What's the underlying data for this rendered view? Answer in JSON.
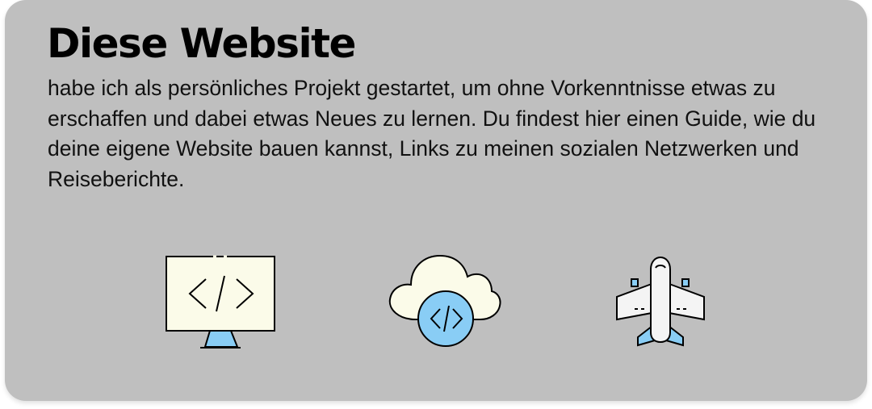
{
  "card": {
    "title": "Diese Website",
    "description": "habe ich als persönliches Projekt gestartet, um ohne Vorkenntnisse etwas zu erschaffen und dabei etwas Neues zu lernen. Du findest hier einen Guide, wie du deine eigene Website bauen kannst, Links zu meinen sozialen Netzwerken und Reiseberichte."
  },
  "icons": [
    {
      "name": "monitor-code-icon"
    },
    {
      "name": "cloud-code-icon"
    },
    {
      "name": "airplane-icon"
    }
  ],
  "colors": {
    "card_background": "#bfbfbf",
    "icon_light_fill": "#fbfbe9",
    "icon_blue_fill": "#89cdf5",
    "icon_stroke": "#000000"
  }
}
